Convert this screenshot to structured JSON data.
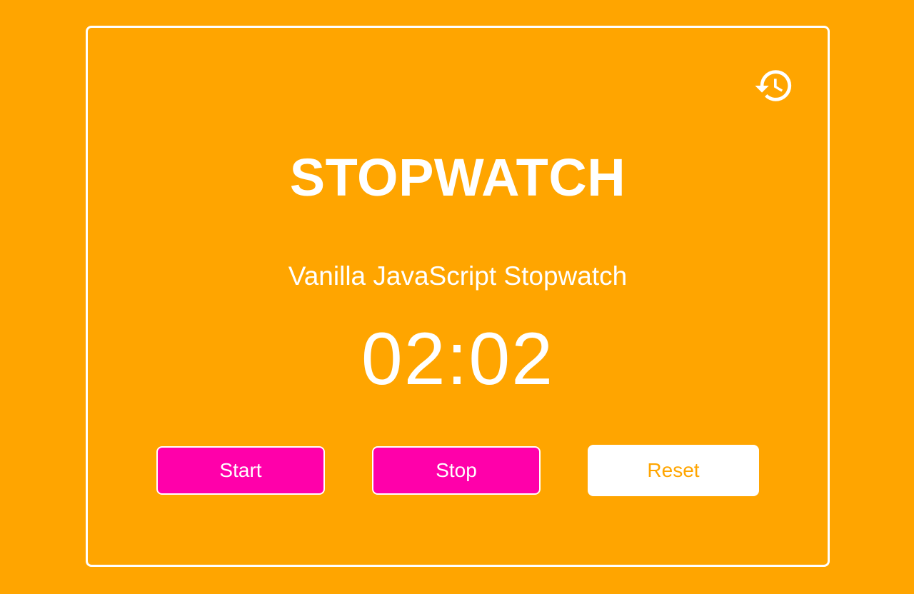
{
  "app": {
    "title": "STOPWATCH",
    "subtitle": "Vanilla JavaScript Stopwatch",
    "time_display": "02:02"
  },
  "controls": {
    "start_label": "Start",
    "stop_label": "Stop",
    "reset_label": "Reset",
    "history_icon": "history-icon"
  },
  "colors": {
    "background": "#FFA500",
    "accent_button": "#FF00AA",
    "text": "#FFFFFF"
  }
}
